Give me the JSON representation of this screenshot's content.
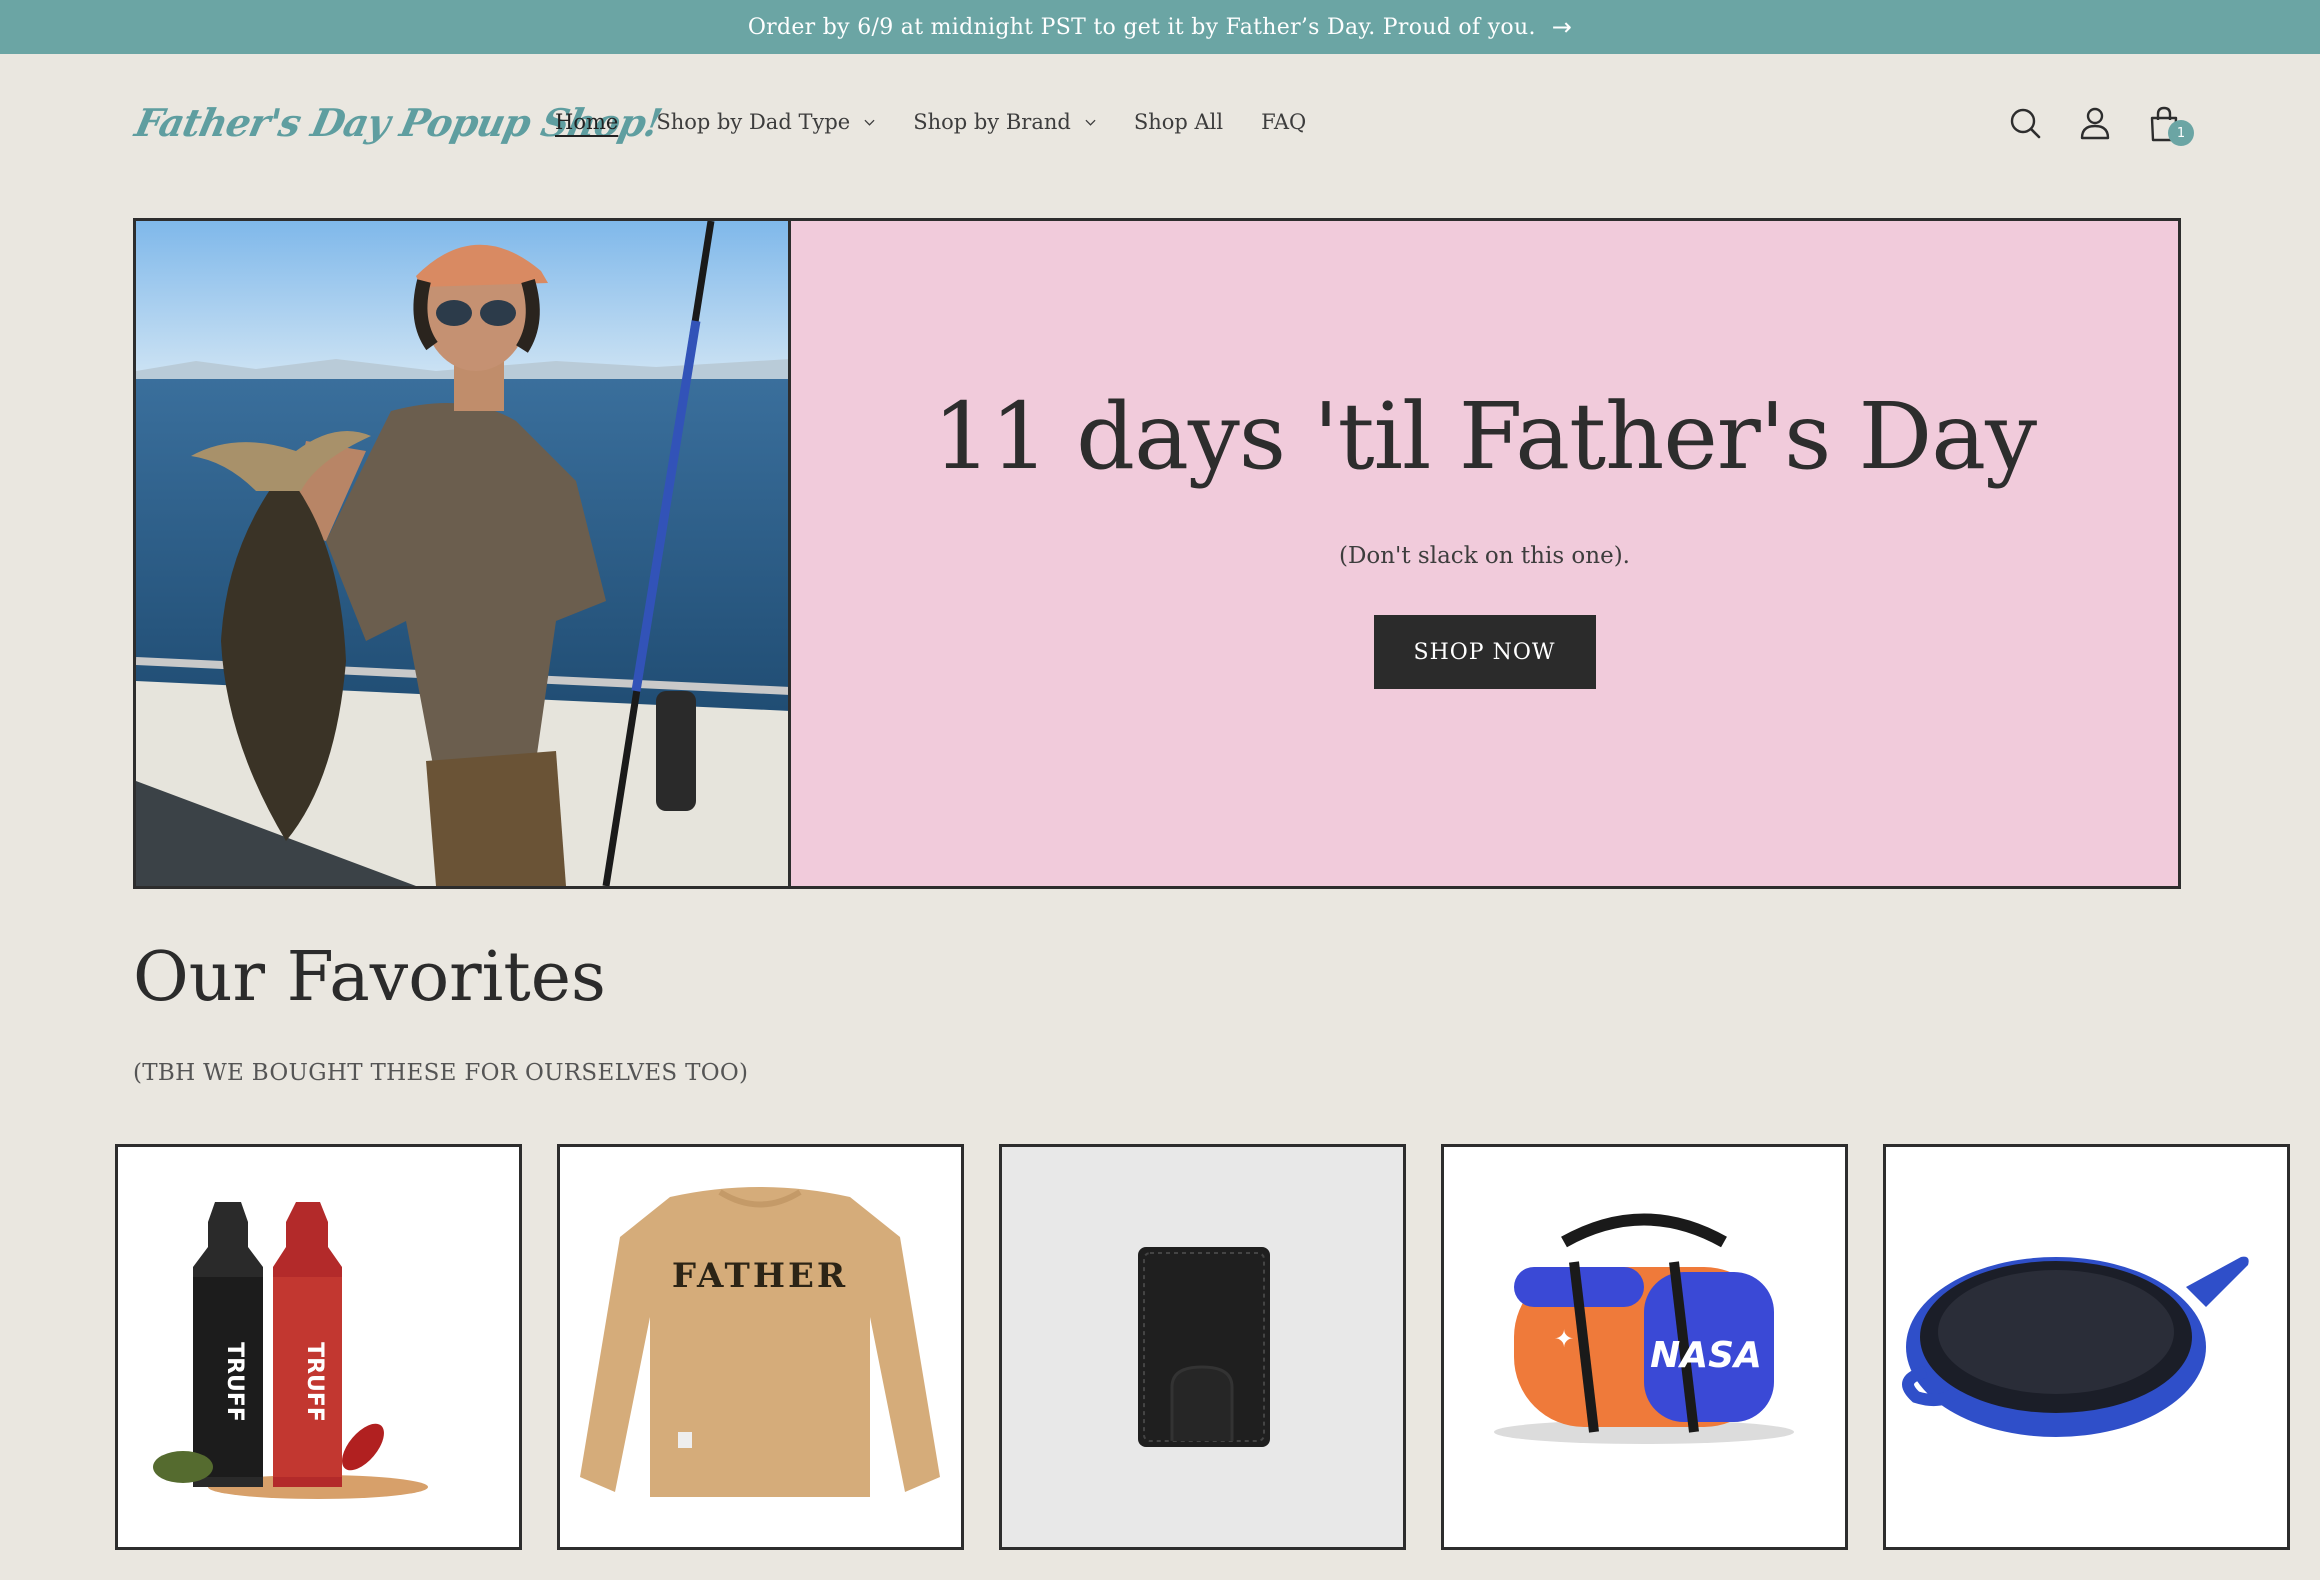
{
  "announcement": {
    "text": "Order by 6/9 at midnight PST to get it by Father’s Day. Proud of you.",
    "arrow": "→"
  },
  "header": {
    "logo": "Father's Day Popup Shop!",
    "nav": [
      {
        "label": "Home",
        "active": true,
        "dropdown": false
      },
      {
        "label": "Shop by Dad Type",
        "active": false,
        "dropdown": true
      },
      {
        "label": "Shop by Brand",
        "active": false,
        "dropdown": true
      },
      {
        "label": "Shop All",
        "active": false,
        "dropdown": false
      },
      {
        "label": "FAQ",
        "active": false,
        "dropdown": false
      }
    ],
    "icons": [
      "search-icon",
      "account-icon",
      "cart-icon"
    ],
    "cart_count": "1"
  },
  "hero": {
    "title": "11 days 'til Father's Day",
    "subtitle": "(Don't slack on this one).",
    "button": "SHOP NOW"
  },
  "favorites": {
    "title": "Our Favorites",
    "subtitle": "(TBH WE BOUGHT THESE FOR OURSELVES TOO)",
    "products": [
      {
        "name": "truff-hot-sauce",
        "bottle_text": "TRUFF"
      },
      {
        "name": "father-sweatshirt",
        "print": "FATHER"
      },
      {
        "name": "black-wallet"
      },
      {
        "name": "nasa-duffel-bag",
        "print": "NASA"
      },
      {
        "name": "blue-cast-iron-skillet"
      }
    ]
  },
  "colors": {
    "teal": "#6ba5a4",
    "background": "#eae7e0",
    "hero_pink": "#f1cbdb",
    "dark": "#2b2b2b"
  }
}
